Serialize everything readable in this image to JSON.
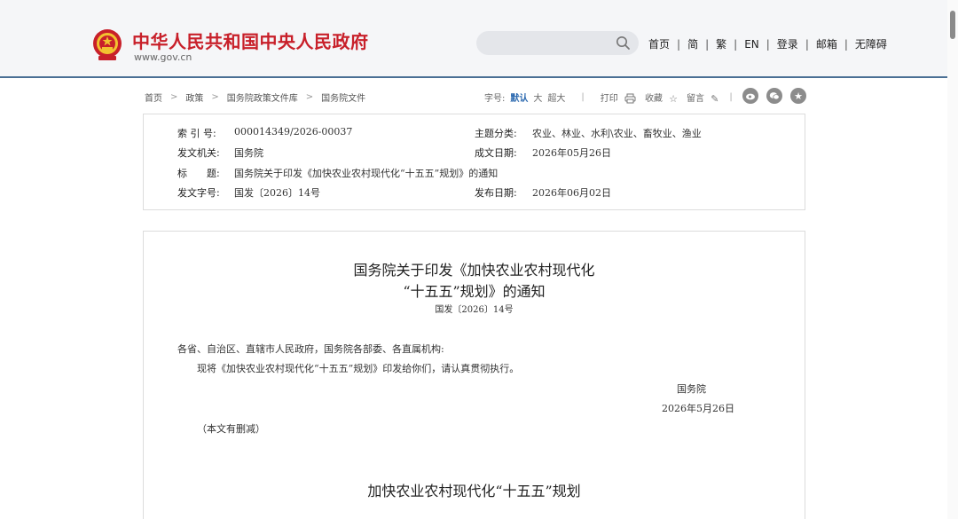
{
  "header": {
    "site_title": "中华人民共和国中央人民政府",
    "site_domain": "www.gov.cn",
    "search": {
      "placeholder": ""
    },
    "nav": [
      "首页",
      "简",
      "繁",
      "EN",
      "登录",
      "邮箱",
      "无障碍"
    ],
    "colors": {
      "brand_red": "#c8202a",
      "accent_blue": "#2d6ab0",
      "header_line": "#4a6f94"
    }
  },
  "breadcrumb": [
    "首页",
    "政策",
    "国务院政策文件库",
    "国务院文件"
  ],
  "tools": {
    "font_label": "字号:",
    "font_default": "默认",
    "font_large": "大",
    "font_xlarge": "超大",
    "print": "打印",
    "favorite": "收藏",
    "comment": "留言"
  },
  "info": {
    "index_label": "索 引 号:",
    "index_value": "000014349/2026-00037",
    "topic_label": "主题分类:",
    "topic_value": "农业、林业、水利\\农业、畜牧业、渔业",
    "issuer_label": "发文机关:",
    "issuer_value": "国务院",
    "made_label": "成文日期:",
    "made_value": "2026年05月26日",
    "title_label": "标　　题:",
    "title_value": "国务院关于印发《加快农业农村现代化“十五五”规划》的通知",
    "docno_label": "发文字号:",
    "docno_value": "国发〔2026〕14号",
    "published_label": "发布日期:",
    "published_value": "2026年06月02日"
  },
  "article": {
    "title_line1": "国务院关于印发《加快农业农村现代化",
    "title_line2": "“十五五”规划》的通知",
    "doc_number": "国发〔2026〕14号",
    "salutation": "各省、自治区、直辖市人民政府，国务院各部委、各直属机构:",
    "body": "现将《加快农业农村现代化“十五五”规划》印发给你们，请认真贯彻执行。",
    "signer": "国务院",
    "date": "2026年5月26日",
    "note": "（本文有删减）",
    "plan_title": "加快农业农村现代化“十五五”规划"
  }
}
